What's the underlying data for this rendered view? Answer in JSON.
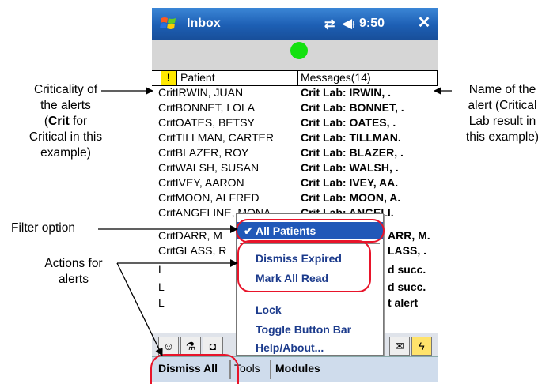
{
  "app": {
    "title": "Inbox",
    "time": "9:50",
    "icons": {
      "windows": "windows-flag-icon",
      "sync": "sync-arrows-icon",
      "volume": "speaker-icon",
      "close": "close-icon"
    },
    "status_color": "#13e10f"
  },
  "table": {
    "columns": {
      "flag": "!",
      "patient": "Patient",
      "messages": "Messages(14)"
    },
    "rows": [
      {
        "patient": "CritIRWIN, JUAN",
        "message": "Crit Lab: IRWIN, ."
      },
      {
        "patient": "CritBONNET, LOLA",
        "message": "Crit Lab: BONNET, ."
      },
      {
        "patient": "CritOATES, BETSY",
        "message": "Crit Lab: OATES, ."
      },
      {
        "patient": "CritTILLMAN, CARTER",
        "message": "Crit Lab: TILLMAN."
      },
      {
        "patient": "CritBLAZER, ROY",
        "message": "Crit Lab: BLAZER, ."
      },
      {
        "patient": "CritWALSH, SUSAN",
        "message": "Crit Lab: WALSH, ."
      },
      {
        "patient": "CritIVEY, AARON",
        "message": "Crit Lab: IVEY, AA."
      },
      {
        "patient": "CritMOON, ALFRED",
        "message": "Crit Lab: MOON, A."
      },
      {
        "patient": "CritANGELINE, MONA",
        "message": "Crit Lab: ANGELI."
      },
      {
        "patient": "CritDARR, M",
        "message": "ARR, M."
      },
      {
        "patient": "CritGLASS, R",
        "message": "LASS, ."
      },
      {
        "patient": "L",
        "message": "d succ."
      },
      {
        "patient": "L",
        "message": "d succ."
      },
      {
        "patient": "L",
        "message": "t alert"
      }
    ]
  },
  "menu": {
    "items": [
      {
        "label": "All Patients",
        "checked": true
      },
      {
        "label": "Dismiss Expired"
      },
      {
        "label": "Mark All Read"
      },
      {
        "label": "Lock"
      },
      {
        "label": "Toggle Button Bar"
      },
      {
        "label": "Help/About..."
      }
    ]
  },
  "bottom_menu": {
    "dismiss_all": "Dismiss All",
    "tools": "Tools",
    "modules": "Modules"
  },
  "annotations": {
    "criticality": [
      "Criticality of",
      "the alerts",
      "(Crit for",
      "Critical in this",
      "example)"
    ],
    "criticality_bold": "Crit",
    "name": [
      "Name of the",
      "alert (Critical",
      "Lab result in",
      "this example)"
    ],
    "filter": "Filter option",
    "actions": [
      "Actions for",
      "alerts"
    ]
  },
  "colors": {
    "highlight_red": "#e8142a",
    "title_blue": "#1d5fb4",
    "menu_selected": "#2158b8"
  }
}
